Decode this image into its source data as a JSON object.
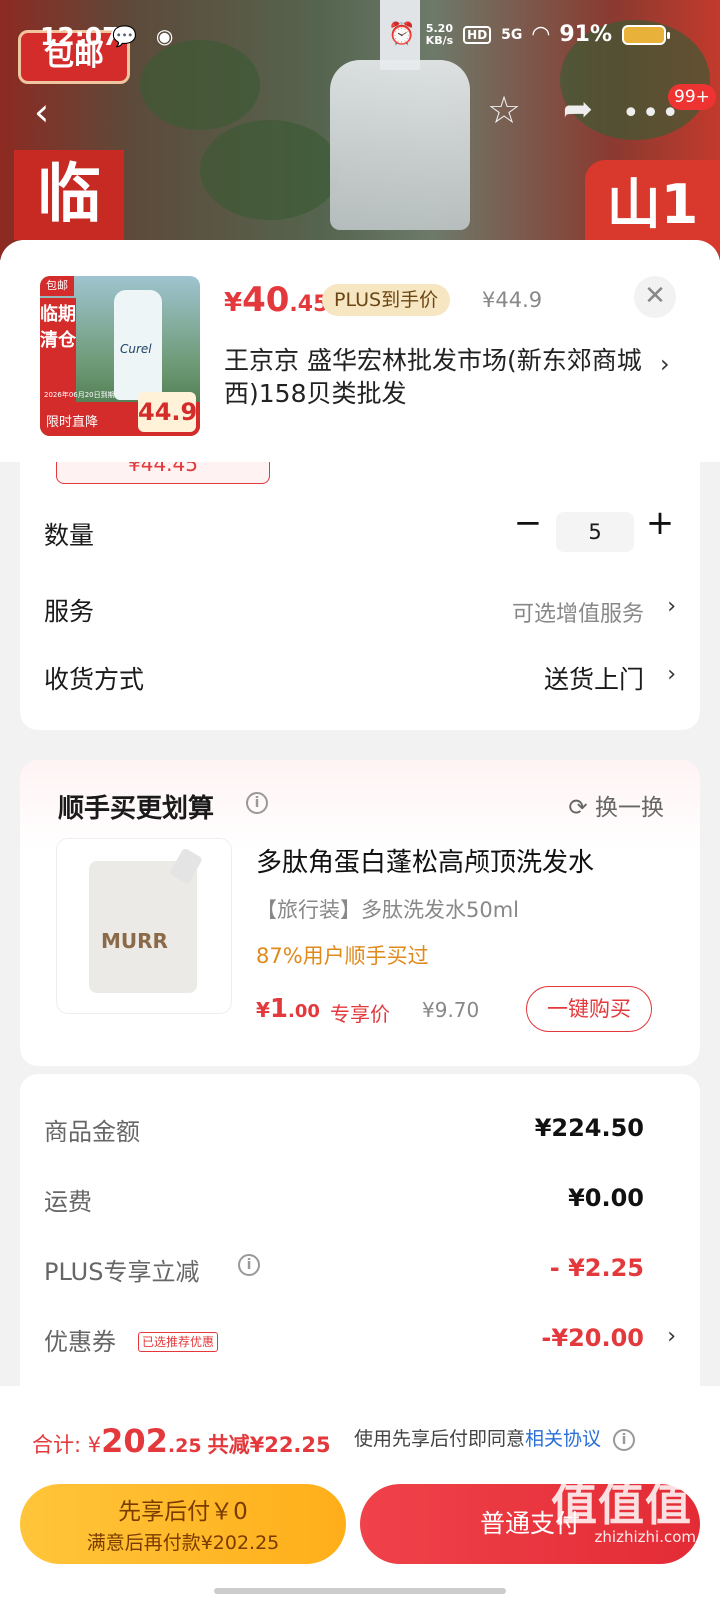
{
  "status_bar": {
    "time": "12:07",
    "net_speed": "5.20",
    "net_unit": "KB/s",
    "hd": "HD",
    "signal": "5G",
    "battery": "91%"
  },
  "background": {
    "logo_text": "包邮",
    "banner_char": "临",
    "right_badge": "山1"
  },
  "nav": {
    "more_badge": "99+"
  },
  "product": {
    "thumb_tag": "包邮",
    "thumb_side": "临期清仓",
    "thumb_brand": "Curel",
    "thumb_bar": "限时直降",
    "thumb_price": "44.9",
    "thumb_date": "2026年06月20日到期",
    "price_symbol": "¥",
    "price_int": "40",
    "price_dec": ".45",
    "plus_tag": "PLUS到手价",
    "orig_price": "¥44.9",
    "address": "王京京  盛华宏林批发市场(新东郊商城西)158贝类批发"
  },
  "options": {
    "spec_price": "¥44.45",
    "qty_label": "数量",
    "qty_value": "5",
    "service_label": "服务",
    "service_value": "可选增值服务",
    "delivery_label": "收货方式",
    "delivery_value": "送货上门"
  },
  "recommend": {
    "title": "顺手买更划算",
    "swap": "换一换",
    "logo": "MURR",
    "name": "多肽角蛋白蓬松高颅顶洗发水",
    "sub": "【旅行装】多肽洗发水50ml",
    "rate": "87%用户顺手买过",
    "price_symbol": "¥",
    "price_int": "1",
    "price_dec": ".00",
    "exclusive": "专享价",
    "orig": "¥9.70",
    "buy": "一键购买"
  },
  "summary": {
    "goods_label": "商品金额",
    "goods_value": "¥224.50",
    "ship_label": "运费",
    "ship_value": "¥0.00",
    "plus_label": "PLUS专享立减",
    "plus_value": "- ¥2.25",
    "coupon_label": "优惠券",
    "coupon_tag": "已选推荐优惠",
    "coupon_value": "-¥20.00"
  },
  "footer": {
    "total_label": "合计: ¥",
    "total_int": "202",
    "total_dec": ".25",
    "saved": "共减¥22.25",
    "agree_text": "使用先享后付即同意",
    "agree_link": "相关协议",
    "pay_later_l1": "先享后付￥0",
    "pay_later_l2": "满意后再付款¥202.25",
    "pay_normal": "普通支付",
    "watermark": "值值值",
    "watermark_sub": "zhizhizhi.com"
  }
}
